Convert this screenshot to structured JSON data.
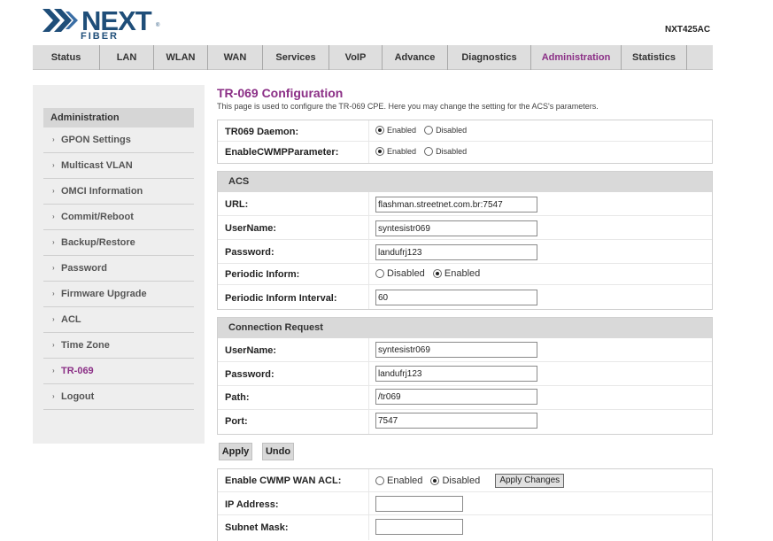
{
  "brand": {
    "name": "NEXT",
    "sub": "FIBER",
    "reg": "®",
    "model": "NXT425AC",
    "colors": {
      "brand": "#1f4e79",
      "accent": "#8b2f86"
    }
  },
  "nav": [
    "Status",
    "LAN",
    "WLAN",
    "WAN",
    "Services",
    "VoIP",
    "Advance",
    "Diagnostics",
    "Administration",
    "Statistics"
  ],
  "nav_active": "Administration",
  "sidebar": {
    "header": "Administration",
    "items": [
      "GPON Settings",
      "Multicast VLAN",
      "OMCI Information",
      "Commit/Reboot",
      "Backup/Restore",
      "Password",
      "Firmware Upgrade",
      "ACL",
      "Time Zone",
      "TR-069",
      "Logout"
    ],
    "active": "TR-069"
  },
  "page": {
    "title": "TR-069 Configuration",
    "description": "This page is used to configure the TR-069 CPE. Here you may change the setting for the ACS's parameters."
  },
  "general": {
    "daemon_label": "TR069 Daemon:",
    "cwmp_label": "EnableCWMPParameter:",
    "enabled": "Enabled",
    "disabled": "Disabled",
    "daemon_value": "Enabled",
    "cwmp_value": "Enabled"
  },
  "acs": {
    "header": "ACS",
    "url_label": "URL:",
    "url": "flashman.streetnet.com.br:7547",
    "username_label": "UserName:",
    "username": "syntesistr069",
    "password_label": "Password:",
    "password": "landufrj123",
    "periodic_label": "Periodic Inform:",
    "periodic_value": "Enabled",
    "disabled": "Disabled",
    "enabled": "Enabled",
    "interval_label": "Periodic Inform Interval:",
    "interval": "60"
  },
  "conn": {
    "header": "Connection Request",
    "username_label": "UserName:",
    "username": "syntesistr069",
    "password_label": "Password:",
    "password": "landufrj123",
    "path_label": "Path:",
    "path": "/tr069",
    "port_label": "Port:",
    "port": "7547"
  },
  "buttons": {
    "apply": "Apply",
    "undo": "Undo"
  },
  "acl": {
    "enable_label": "Enable CWMP WAN ACL:",
    "enabled": "Enabled",
    "disabled": "Disabled",
    "value": "Disabled",
    "apply_changes": "Apply Changes",
    "ip_label": "IP Address:",
    "ip": "",
    "mask_label": "Subnet Mask:",
    "mask": ""
  }
}
